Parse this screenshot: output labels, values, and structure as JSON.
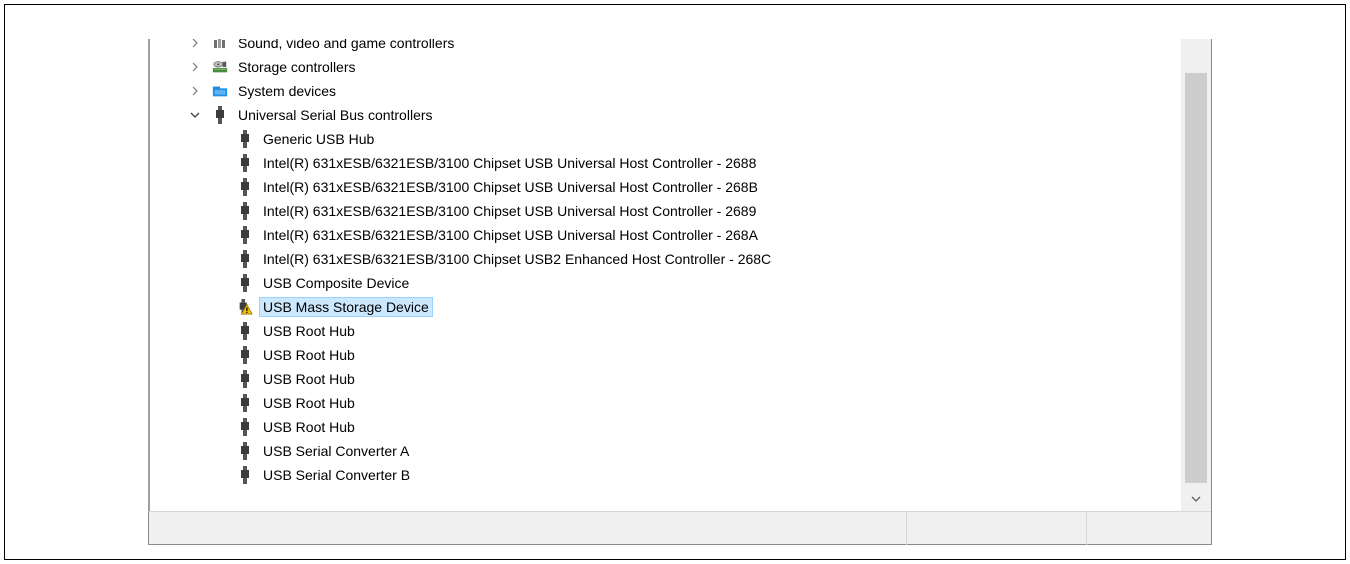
{
  "tree": {
    "categories": [
      {
        "label": "Sound, video and game controllers",
        "expander": "chevron-right",
        "icon": "speaker-icon"
      },
      {
        "label": "Storage controllers",
        "expander": "chevron-right",
        "icon": "storage-controller-icon"
      },
      {
        "label": "System devices",
        "expander": "chevron-right",
        "icon": "computer-folder-icon"
      },
      {
        "label": "Universal Serial Bus controllers",
        "expander": "chevron-down",
        "icon": "usb-plug-icon"
      }
    ],
    "usb_devices": [
      {
        "label": "Generic USB Hub"
      },
      {
        "label": "Intel(R) 631xESB/6321ESB/3100 Chipset USB Universal Host Controller - 2688"
      },
      {
        "label": "Intel(R) 631xESB/6321ESB/3100 Chipset USB Universal Host Controller - 268B"
      },
      {
        "label": "Intel(R) 631xESB/6321ESB/3100 Chipset USB Universal Host Controller - 2689"
      },
      {
        "label": "Intel(R) 631xESB/6321ESB/3100 Chipset USB Universal Host Controller - 268A"
      },
      {
        "label": "Intel(R) 631xESB/6321ESB/3100 Chipset USB2 Enhanced Host Controller - 268C"
      },
      {
        "label": "USB Composite Device"
      },
      {
        "label": "USB Mass Storage Device",
        "warning": true,
        "selected": true
      },
      {
        "label": "USB Root Hub"
      },
      {
        "label": "USB Root Hub"
      },
      {
        "label": "USB Root Hub"
      },
      {
        "label": "USB Root Hub"
      },
      {
        "label": "USB Root Hub"
      },
      {
        "label": "USB Serial Converter A"
      },
      {
        "label": "USB Serial Converter B"
      }
    ]
  },
  "colors": {
    "selection_bg": "#cce8ff",
    "selection_border": "#99d1ff",
    "warning": "#f2c200",
    "scrollbar_thumb": "#cdcdcd"
  }
}
